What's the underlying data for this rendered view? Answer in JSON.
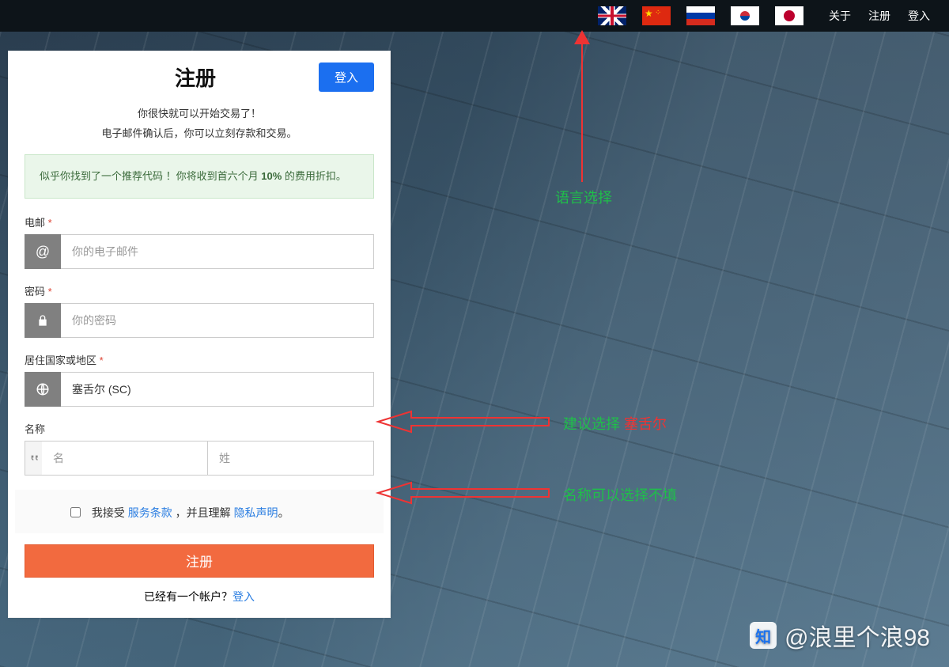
{
  "nav": {
    "about": "关于",
    "register": "注册",
    "login": "登入"
  },
  "form": {
    "title": "注册",
    "login_btn": "登入",
    "intro1": "你很快就可以开始交易了！",
    "intro2": "电子邮件确认后，你可以立刻存款和交易。",
    "promo_a": "似乎你找到了一个推荐代码 ！你将收到首六个月 ",
    "promo_pct": "10%",
    "promo_b": " 的费用折扣。",
    "email_label": "电邮",
    "email_ph": "你的电子邮件",
    "pwd_label": "密码",
    "pwd_ph": "你的密码",
    "country_label": "居住国家或地区",
    "country_value": "塞舌尔 (SC)",
    "name_label": "名称",
    "first_ph": "名",
    "last_ph": "姓",
    "terms_a": "我接受 ",
    "terms_link": "服务条款",
    "terms_b": " ，并且理解 ",
    "privacy_link": "隐私声明",
    "terms_c": "。",
    "submit": "注册",
    "already_a": "已经有一个帐户？",
    "already_link": "登入"
  },
  "annot": {
    "lang": "语言选择",
    "suggest_a": "建议选择 ",
    "suggest_b": "塞舌尔",
    "name_opt": "名称可以选择不填"
  },
  "watermark": {
    "logo": "知",
    "text": "@浪里个浪98"
  }
}
